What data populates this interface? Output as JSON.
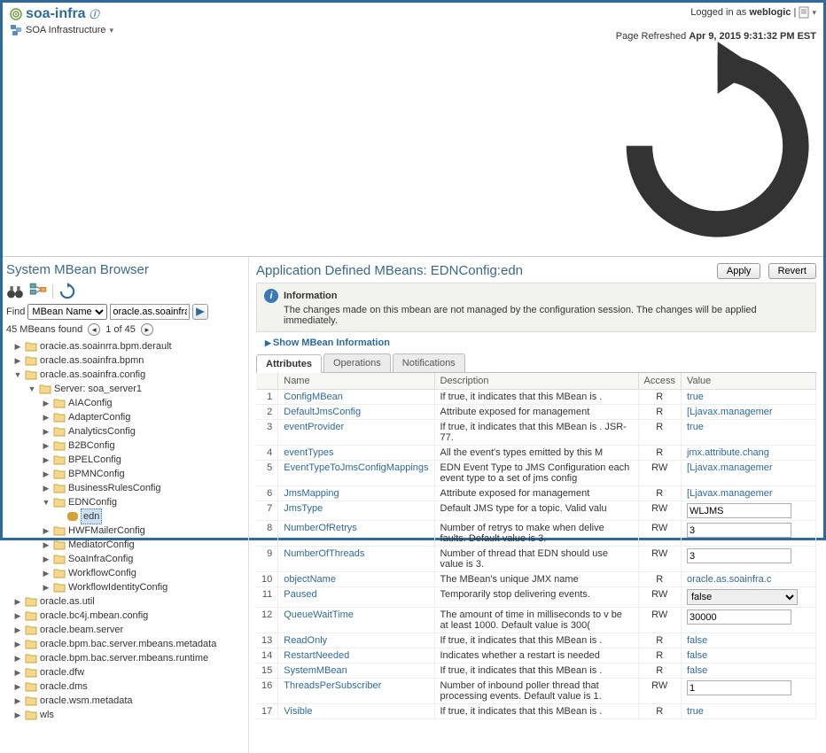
{
  "header": {
    "target_title": "soa-infra",
    "subtitle": "SOA Infrastructure",
    "logged_in_label": "Logged in as",
    "user": "weblogic",
    "refresh_label": "Page Refreshed",
    "refresh_time": "Apr 9, 2015 9:31:32 PM EST"
  },
  "page_title": "System MBean Browser",
  "find": {
    "label": "Find",
    "filter_selected": "MBean Name",
    "value": "oracle.as.soainfra.c"
  },
  "results": {
    "count_label": "45 MBeans found",
    "position": "1 of 45"
  },
  "tree": [
    {
      "indent": 0,
      "toggle": "▶",
      "label": "oracie.as.soainrra.bpm.derault"
    },
    {
      "indent": 0,
      "toggle": "▶",
      "label": "oracle.as.soainfra.bpmn"
    },
    {
      "indent": 0,
      "toggle": "▼",
      "label": "oracle.as.soainfra.config"
    },
    {
      "indent": 1,
      "toggle": "▼",
      "label": "Server: soa_server1"
    },
    {
      "indent": 2,
      "toggle": "▶",
      "label": "AIAConfig"
    },
    {
      "indent": 2,
      "toggle": "▶",
      "label": "AdapterConfig"
    },
    {
      "indent": 2,
      "toggle": "▶",
      "label": "AnalyticsConfig"
    },
    {
      "indent": 2,
      "toggle": "▶",
      "label": "B2BConfig"
    },
    {
      "indent": 2,
      "toggle": "▶",
      "label": "BPELConfig"
    },
    {
      "indent": 2,
      "toggle": "▶",
      "label": "BPMNConfig"
    },
    {
      "indent": 2,
      "toggle": "▶",
      "label": "BusinessRulesConfig"
    },
    {
      "indent": 2,
      "toggle": "▼",
      "label": "EDNConfig"
    },
    {
      "indent": 3,
      "toggle": "",
      "label": "edn",
      "bean": true,
      "selected": true
    },
    {
      "indent": 2,
      "toggle": "▶",
      "label": "HWFMailerConfig"
    },
    {
      "indent": 2,
      "toggle": "▶",
      "label": "MediatorConfig"
    },
    {
      "indent": 2,
      "toggle": "▶",
      "label": "SoaInfraConfig"
    },
    {
      "indent": 2,
      "toggle": "▶",
      "label": "WorkflowConfig"
    },
    {
      "indent": 2,
      "toggle": "▶",
      "label": "WorkflowIdentityConfig"
    },
    {
      "indent": 0,
      "toggle": "▶",
      "label": "oracle.as.util"
    },
    {
      "indent": 0,
      "toggle": "▶",
      "label": "oracle.bc4j.mbean.config"
    },
    {
      "indent": 0,
      "toggle": "▶",
      "label": "oracle.beam.server"
    },
    {
      "indent": 0,
      "toggle": "▶",
      "label": "oracle.bpm.bac.server.mbeans.metadata"
    },
    {
      "indent": 0,
      "toggle": "▶",
      "label": "oracle.bpm.bac.server.mbeans.runtime"
    },
    {
      "indent": 0,
      "toggle": "▶",
      "label": "oracle.dfw"
    },
    {
      "indent": 0,
      "toggle": "▶",
      "label": "oracle.dms"
    },
    {
      "indent": 0,
      "toggle": "▶",
      "label": "oracle.wsm.metadata"
    },
    {
      "indent": 0,
      "toggle": "▶",
      "label": "wls"
    }
  ],
  "detail": {
    "title": "Application Defined MBeans: EDNConfig:edn",
    "apply": "Apply",
    "revert": "Revert",
    "info_header": "Information",
    "info_text": "The changes made on this mbean are not managed by the configuration session. The changes will be applied immediately.",
    "show_link": "Show MBean Information",
    "tabs": [
      "Attributes",
      "Operations",
      "Notifications"
    ],
    "cols": {
      "name": "Name",
      "desc": "Description",
      "access": "Access",
      "value": "Value"
    },
    "rows": [
      {
        "n": 1,
        "name": "ConfigMBean",
        "desc": "If true, it indicates that this MBean is .",
        "access": "R",
        "vtype": "link",
        "value": "true"
      },
      {
        "n": 2,
        "name": "DefaultJmsConfig",
        "desc": "Attribute exposed for management",
        "access": "R",
        "vtype": "link",
        "value": "[Ljavax.managemer"
      },
      {
        "n": 3,
        "name": "eventProvider",
        "desc": "If true, it indicates that this MBean is . JSR-77.",
        "access": "R",
        "vtype": "link",
        "value": "true"
      },
      {
        "n": 4,
        "name": "eventTypes",
        "desc": "All the event's types emitted by this M",
        "access": "R",
        "vtype": "link",
        "value": "jmx.attribute.chang"
      },
      {
        "n": 5,
        "name": "EventTypeToJmsConfigMappings",
        "desc": "EDN Event Type to JMS Configuration each event type to a set of jms config",
        "access": "RW",
        "vtype": "link",
        "value": "[Ljavax.managemer"
      },
      {
        "n": 6,
        "name": "JmsMapping",
        "desc": "Attribute exposed for management",
        "access": "R",
        "vtype": "link",
        "value": "[Ljavax.managemer"
      },
      {
        "n": 7,
        "name": "JmsType",
        "desc": "Default JMS type for a topic. Valid valu",
        "access": "RW",
        "vtype": "input",
        "value": "WLJMS"
      },
      {
        "n": 8,
        "name": "NumberOfRetrys",
        "desc": "Number of retrys to make when delive faults. Default value is 3.",
        "access": "RW",
        "vtype": "input",
        "value": "3"
      },
      {
        "n": 9,
        "name": "NumberOfThreads",
        "desc": "Number of thread that EDN should use value is 3.",
        "access": "RW",
        "vtype": "input",
        "value": "3"
      },
      {
        "n": 10,
        "name": "objectName",
        "desc": "The MBean's unique JMX name",
        "access": "R",
        "vtype": "link",
        "value": "oracle.as.soainfra.c"
      },
      {
        "n": 11,
        "name": "Paused",
        "desc": "Temporarily stop delivering events.",
        "access": "RW",
        "vtype": "select",
        "value": "false"
      },
      {
        "n": 12,
        "name": "QueueWaitTime",
        "desc": "The amount of time in milliseconds to v be at least 1000. Default value is 300(",
        "access": "RW",
        "vtype": "input",
        "value": "30000"
      },
      {
        "n": 13,
        "name": "ReadOnly",
        "desc": "If true, it indicates that this MBean is .",
        "access": "R",
        "vtype": "link",
        "value": "false"
      },
      {
        "n": 14,
        "name": "RestartNeeded",
        "desc": "Indicates whether a restart is needed",
        "access": "R",
        "vtype": "link",
        "value": "false"
      },
      {
        "n": 15,
        "name": "SystemMBean",
        "desc": "If true, it indicates that this MBean is .",
        "access": "R",
        "vtype": "link",
        "value": "false"
      },
      {
        "n": 16,
        "name": "ThreadsPerSubscriber",
        "desc": "Number of inbound poller thread that processing events. Default value is 1.",
        "access": "RW",
        "vtype": "input",
        "value": "1"
      },
      {
        "n": 17,
        "name": "Visible",
        "desc": "If true, it indicates that this MBean is .",
        "access": "R",
        "vtype": "link",
        "value": "true"
      }
    ]
  }
}
